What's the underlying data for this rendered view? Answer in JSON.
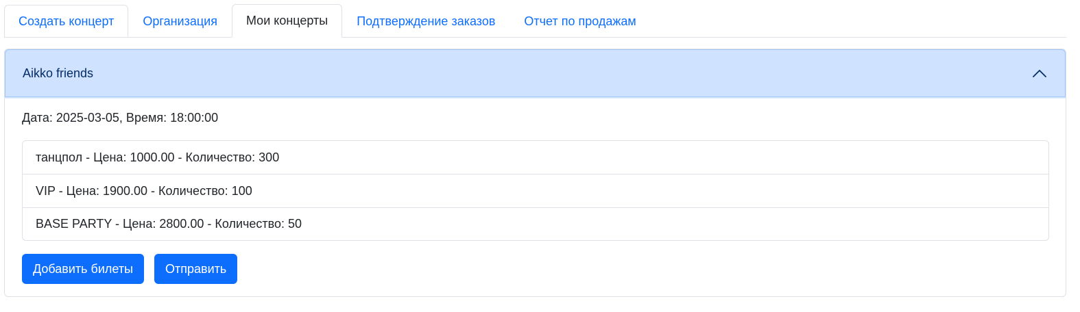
{
  "tabs": [
    {
      "label": "Создать концерт",
      "active": false
    },
    {
      "label": "Организация",
      "active": false
    },
    {
      "label": "Мои концерты",
      "active": true
    },
    {
      "label": "Подтверждение заказов",
      "active": false
    },
    {
      "label": "Отчет по продажам",
      "active": false
    }
  ],
  "concert": {
    "title": "Aikko friends",
    "expanded": true,
    "toggle_icon": "chevron-up-icon",
    "date_line": "Дата: 2025-03-05, Время: 18:00:00",
    "tickets": [
      {
        "text": "танцпол - Цена: 1000.00 - Количество: 300"
      },
      {
        "text": "VIP - Цена: 1900.00 - Количество: 100"
      },
      {
        "text": "BASE PARTY - Цена: 2800.00 - Количество: 50"
      }
    ],
    "add_tickets_label": "Добавить билеты",
    "submit_label": "Отправить"
  },
  "colors": {
    "primary": "#0d6efd",
    "header_bg": "#cfe2ff",
    "header_text": "#052c65",
    "border": "#dee2e6"
  }
}
